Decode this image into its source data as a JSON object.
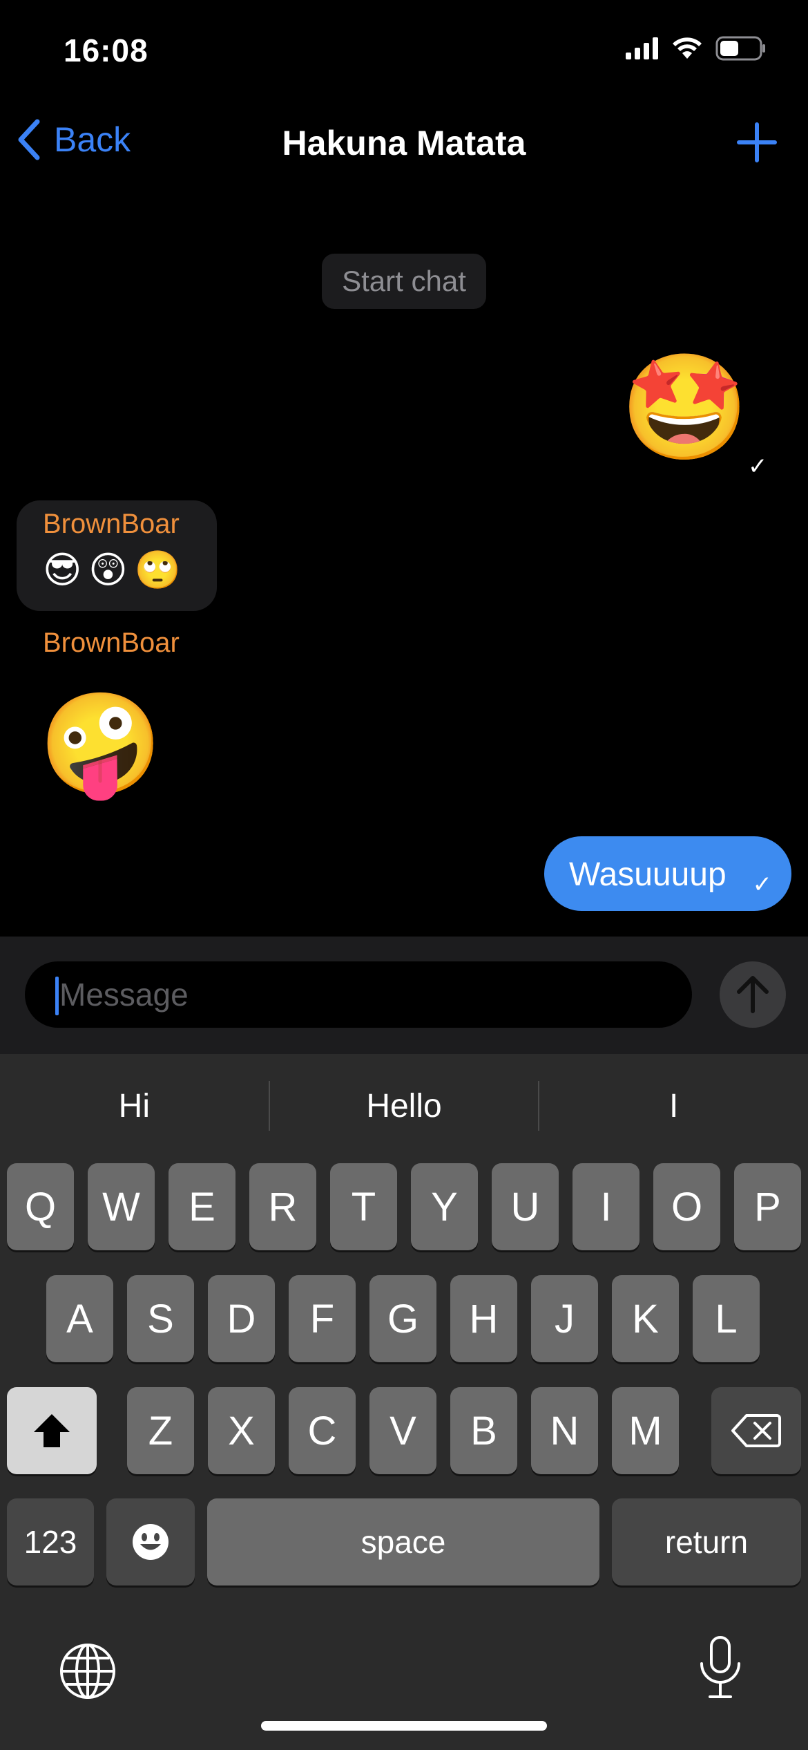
{
  "status_bar": {
    "time": "16:08"
  },
  "nav": {
    "back_label": "Back",
    "title": "Hakuna Matata"
  },
  "chat": {
    "system_message": "Start chat",
    "messages": [
      {
        "type": "sent",
        "content": "🤩",
        "status": "✓"
      },
      {
        "type": "received",
        "sender": "BrownBoar",
        "content": [
          "😎",
          "😲",
          "🙄"
        ]
      },
      {
        "type": "received",
        "sender": "BrownBoar",
        "content": "🤪"
      },
      {
        "type": "sent",
        "content": "Wasuuuup",
        "status": "✓"
      }
    ]
  },
  "composer": {
    "placeholder": "Message"
  },
  "keyboard": {
    "suggestions": [
      "Hi",
      "Hello",
      "I"
    ],
    "row1": [
      "Q",
      "W",
      "E",
      "R",
      "T",
      "Y",
      "U",
      "I",
      "O",
      "P"
    ],
    "row2": [
      "A",
      "S",
      "D",
      "F",
      "G",
      "H",
      "J",
      "K",
      "L"
    ],
    "row3": [
      "Z",
      "X",
      "C",
      "V",
      "B",
      "N",
      "M"
    ],
    "numbers_label": "123",
    "space_label": "space",
    "return_label": "return"
  },
  "colors": {
    "accent": "#3b82f6",
    "sent_bubble": "#3d8bf0",
    "sender_name": "#f0903c",
    "background": "#000000",
    "keyboard_bg": "#2b2b2b"
  },
  "icons": {
    "back": "chevron-left-icon",
    "add": "plus-icon",
    "send": "arrow-up-icon",
    "shift": "shift-icon",
    "delete": "backspace-icon",
    "emoji": "smiley-icon",
    "globe": "globe-icon",
    "mic": "microphone-icon"
  }
}
